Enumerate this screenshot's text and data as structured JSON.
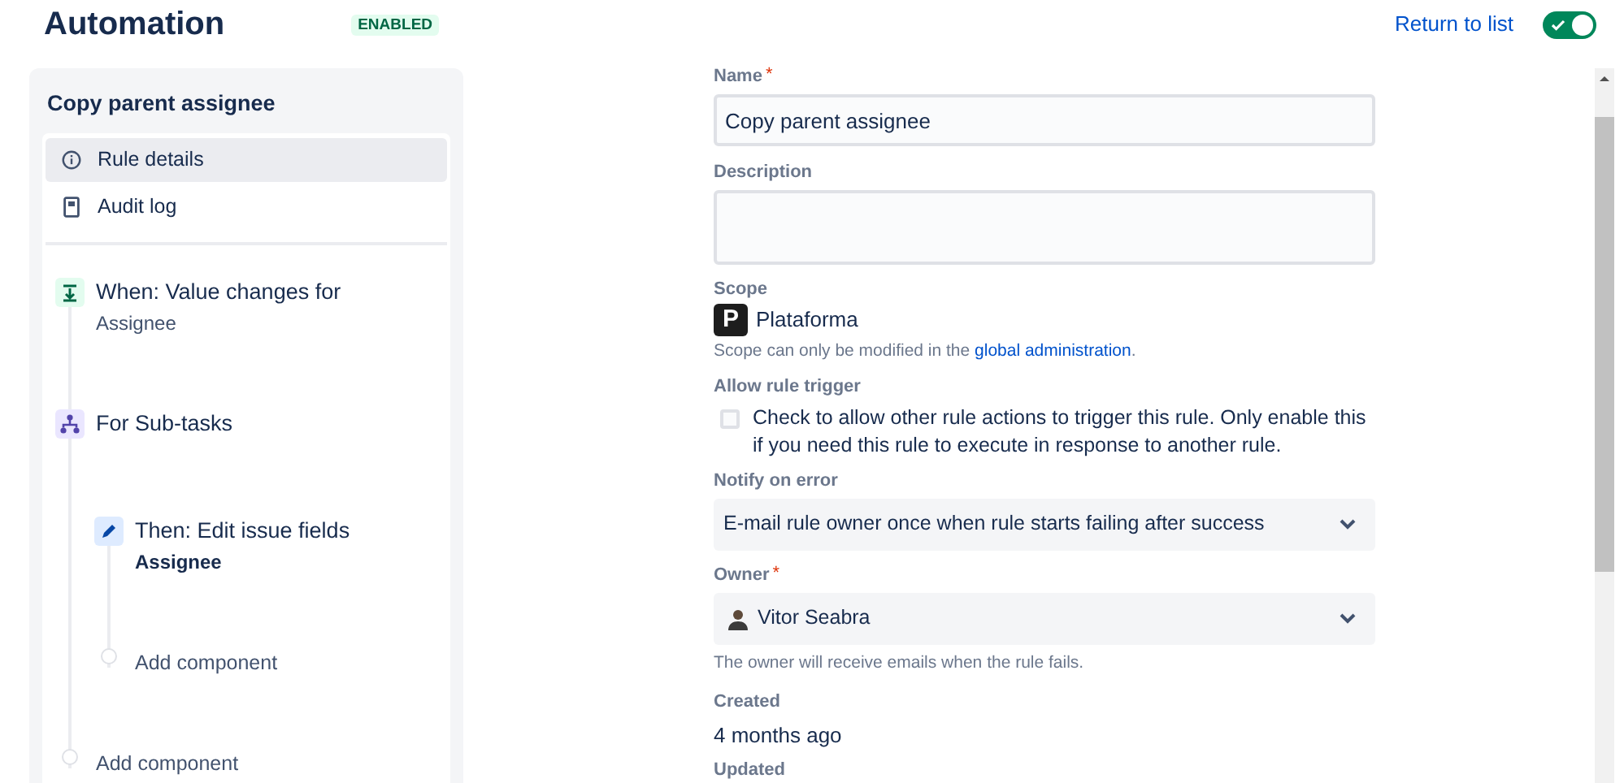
{
  "header": {
    "title": "Automation",
    "status_badge": "ENABLED",
    "return_link": "Return to list",
    "toggle": {
      "on": true
    }
  },
  "sidebar": {
    "title": "Copy parent assignee",
    "nav": [
      {
        "kind": "info",
        "label": "Rule details",
        "selected": true
      },
      {
        "kind": "log",
        "label": "Audit log",
        "selected": false
      }
    ],
    "components": [
      {
        "kind": "trigger",
        "label": "When: Value changes for",
        "detail": "Assignee"
      },
      {
        "kind": "branch",
        "label": "For Sub-tasks",
        "children": [
          {
            "kind": "action",
            "label": "Then: Edit issue fields",
            "detail": "Assignee"
          },
          {
            "kind": "add",
            "label": "Add component"
          }
        ]
      },
      {
        "kind": "add",
        "label": "Add component"
      }
    ]
  },
  "form": {
    "fields": [
      {
        "kind": "text",
        "label": "Name",
        "required_mark": "*",
        "value": "Copy parent assignee"
      },
      {
        "kind": "textarea",
        "label": "Description"
      },
      {
        "kind": "scope",
        "label": "Scope",
        "value": "Plataforma",
        "logo": "P",
        "hint": "Scope can only be modified in the",
        "hint_link": "global administration",
        "hint_end": "."
      },
      {
        "kind": "checkbox",
        "label": "Allow rule trigger",
        "checked": false,
        "text": "Check to allow other rule actions to trigger this rule. Only enable this if you need this rule to execute in response to another rule."
      },
      {
        "kind": "select",
        "label": "Notify on error",
        "value": "E-mail rule owner once when rule starts failing after success"
      },
      {
        "kind": "user",
        "label": "Owner",
        "required_mark": "*",
        "value": "Vitor Seabra",
        "hint": "The owner will receive emails when the rule fails."
      },
      {
        "kind": "static",
        "label": "Created",
        "value": "4 months ago"
      },
      {
        "kind": "static",
        "label": "Updated"
      }
    ]
  }
}
